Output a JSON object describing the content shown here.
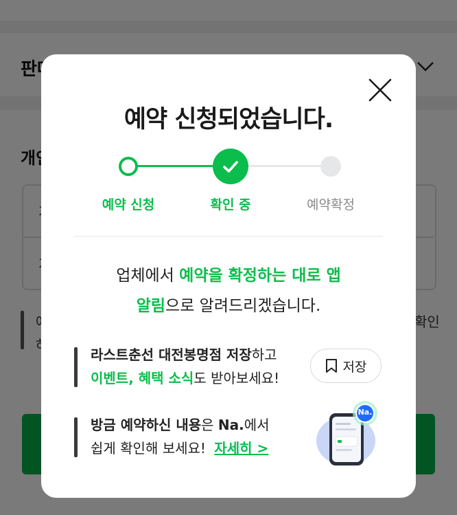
{
  "background": {
    "title_fragment": "판매",
    "section_fragment": "개인",
    "row1_fragment": "가",
    "row2_fragment": "가",
    "note_line1_fragment": "예",
    "note_line1_right": "확인",
    "note_line2_fragment": "하"
  },
  "modal": {
    "title": "예약 신청되었습니다.",
    "steps": [
      {
        "label": "예약 신청",
        "state": "done"
      },
      {
        "label": "확인 중",
        "state": "current"
      },
      {
        "label": "예약확정",
        "state": "pending"
      }
    ],
    "notice": {
      "part1": "업체에서 ",
      "highlight1": "예약을 확정하는 대로 앱",
      "highlight2": "알림",
      "part2": "으로 알려드리겠습니다."
    },
    "store": {
      "name_bold": "라스트춘선 대전봉명점 저장",
      "name_suffix": "하고",
      "highlight": "이벤트, 혜택 소식",
      "suffix": "도 받아보세요!",
      "save_label": "저장"
    },
    "na": {
      "bold1": "방금 예약하신 내용",
      "text1": "은 ",
      "bold2": "Na.",
      "text2": "에서",
      "line2": "쉽게 확인해 보세요!",
      "link_label": "자세히 >",
      "badge_text": "Na."
    }
  },
  "colors": {
    "accent": "#0bbd4c",
    "step_pending": "#e6e7e9",
    "text_dark": "#1a1a1a"
  }
}
